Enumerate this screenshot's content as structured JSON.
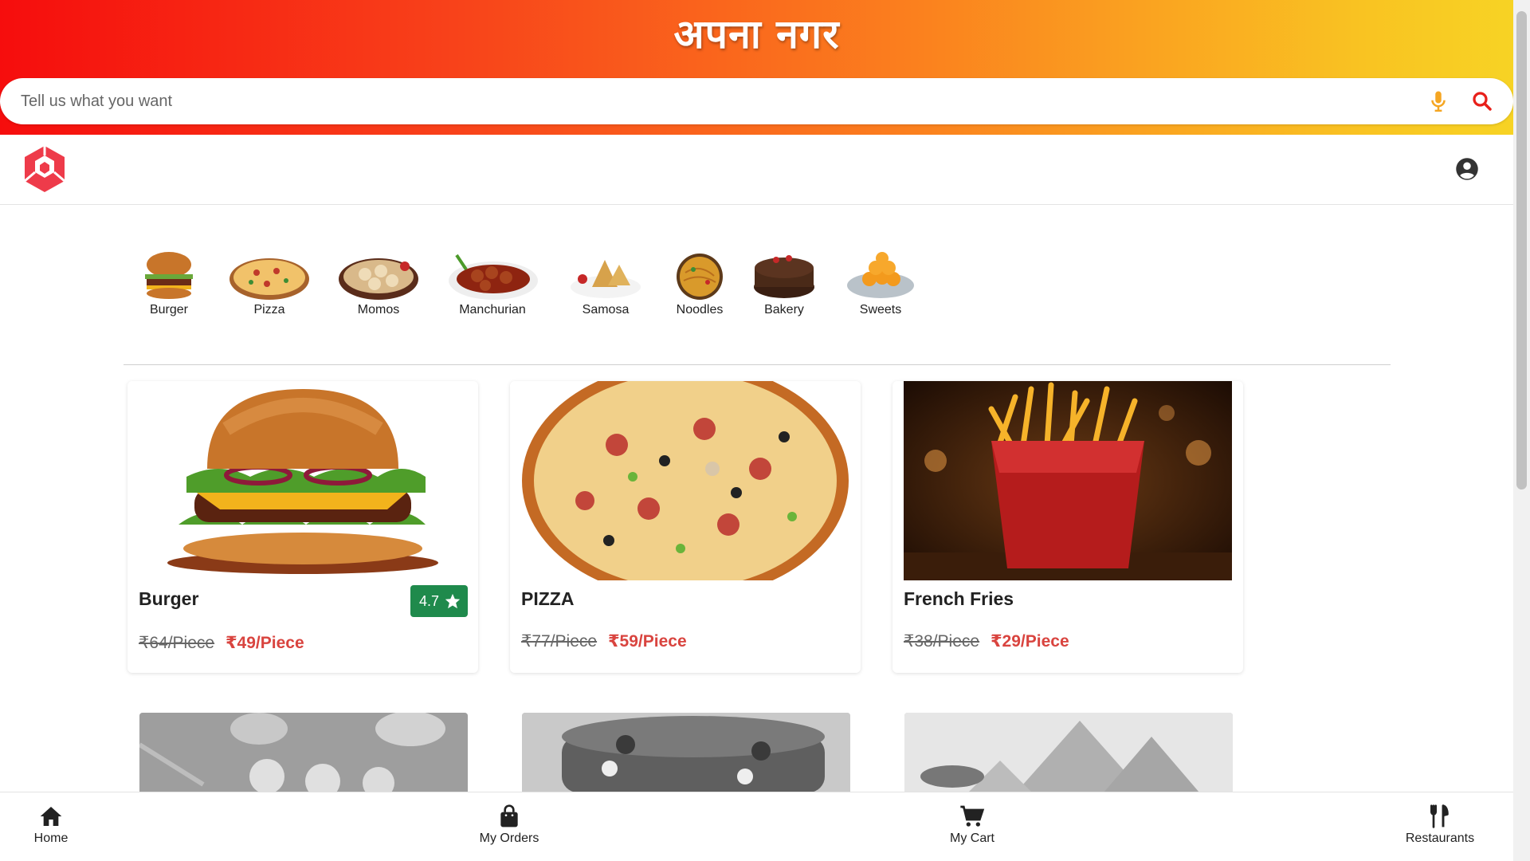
{
  "header": {
    "title": "अपना नगर",
    "search_placeholder": "Tell us what you want",
    "mic_icon": "microphone-icon",
    "search_icon": "search-icon"
  },
  "navbar": {
    "logo_icon": "unity-logo-icon",
    "account_icon": "account-circle-icon"
  },
  "categories": [
    {
      "label": "Burger"
    },
    {
      "label": "Pizza"
    },
    {
      "label": "Momos"
    },
    {
      "label": "Manchurian"
    },
    {
      "label": "Samosa"
    },
    {
      "label": "Noodles"
    },
    {
      "label": "Bakery"
    },
    {
      "label": "Sweets"
    }
  ],
  "products": [
    {
      "name": "Burger",
      "rating": "4.7",
      "old_price": "₹64/Piece",
      "price": "₹49/Piece"
    },
    {
      "name": "PIZZA",
      "old_price": "₹77/Piece",
      "price": "₹59/Piece"
    },
    {
      "name": "French Fries",
      "old_price": "₹38/Piece",
      "price": "₹29/Piece"
    }
  ],
  "bottom_nav": [
    {
      "label": "Home",
      "icon": "home-icon"
    },
    {
      "label": "My Orders",
      "icon": "shopping-bag-icon"
    },
    {
      "label": "My Cart",
      "icon": "cart-icon"
    },
    {
      "label": "Restaurants",
      "icon": "restaurant-icon"
    }
  ],
  "colors": {
    "gradient_start": "#f60d0d",
    "gradient_end": "#f7d324",
    "price_red": "#d9443f",
    "rating_green": "#1f8a4c"
  }
}
